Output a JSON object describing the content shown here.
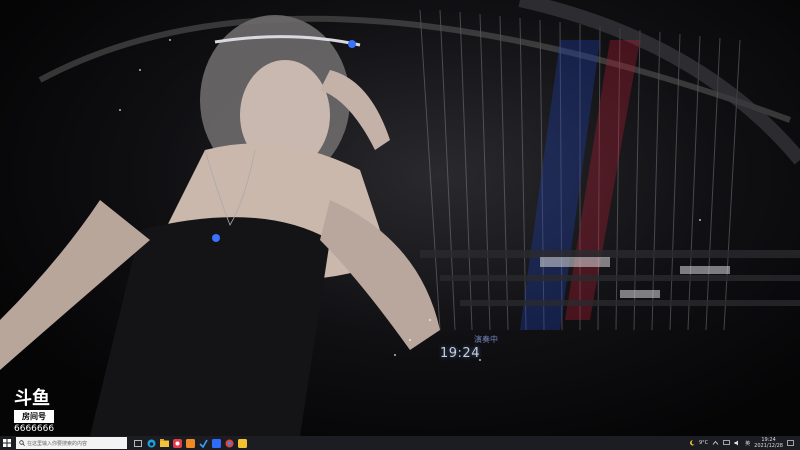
{
  "overlay": {
    "time": "19:24",
    "subtitle": "演奏中"
  },
  "watermark": {
    "logo": "斗鱼",
    "room_label": "房间号",
    "room_id": "6666666"
  },
  "taskbar": {
    "search_placeholder": "在这里输入你要搜索的内容",
    "apps": [
      "task-view",
      "edge",
      "explorer",
      "app-red",
      "app-orange",
      "app-blue",
      "app-blue-2",
      "app-yellow"
    ],
    "tray": {
      "weather": "9°C",
      "lang": "英",
      "time": "19:24",
      "date": "2021/12/28"
    }
  },
  "colors": {
    "taskbar_bg": "#1b1d22",
    "accent_blue": "#2f6bff",
    "accent_red": "#d12b3a"
  }
}
